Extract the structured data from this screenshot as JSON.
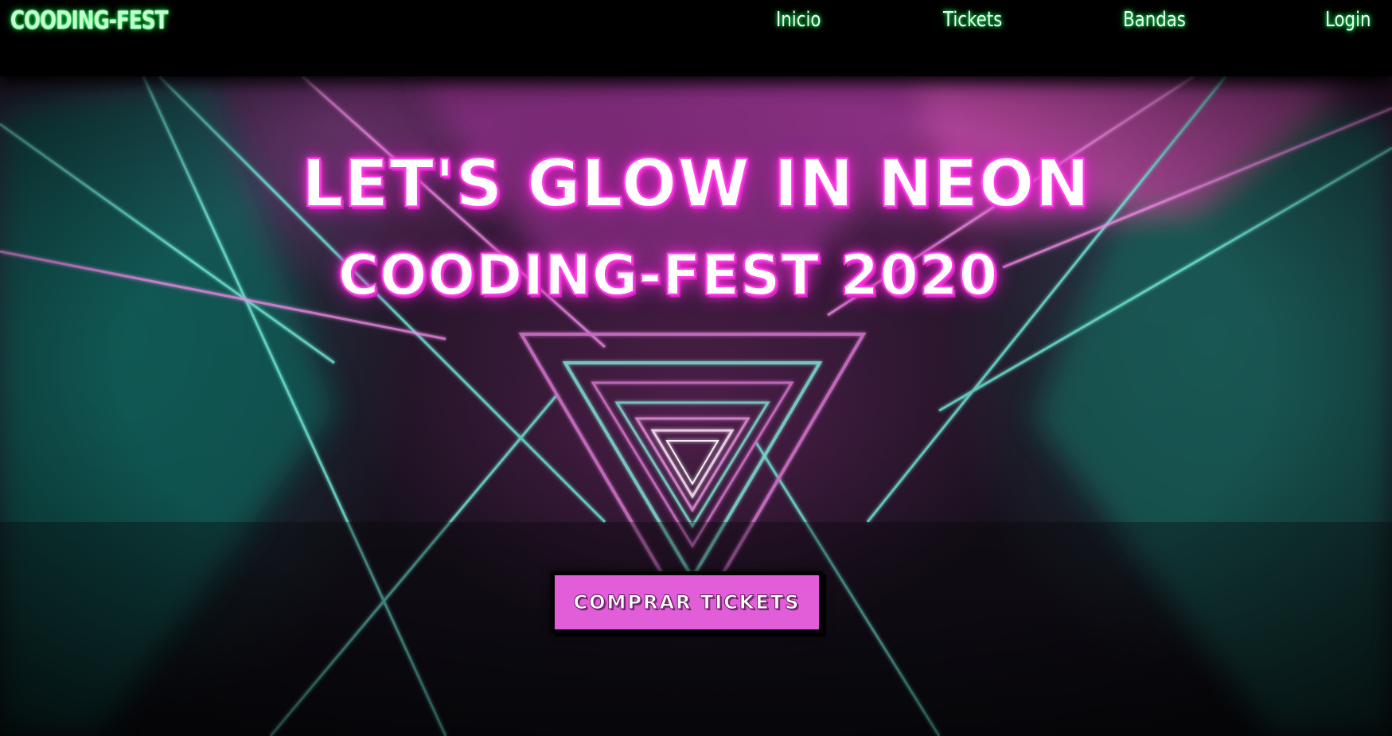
{
  "navbar": {
    "brand": "COODING-FEST",
    "links": [
      "Inicio",
      "Tickets",
      "Bandas",
      "Login"
    ]
  },
  "hero": {
    "headline": "LET'S GLOW IN NEON",
    "subheadline": "COODING-FEST 2020",
    "cta_label": "COMPRAR TICKETS"
  },
  "colors": {
    "nav_glow": "#2bff5e",
    "headline_glow": "#ff2fd8",
    "cta_background": "#e25ed8",
    "teal_laser": "#5fd6c8",
    "pink_laser": "#e57ad9"
  },
  "icons": {
    "background": "neon-triangle-tunnel-image"
  }
}
